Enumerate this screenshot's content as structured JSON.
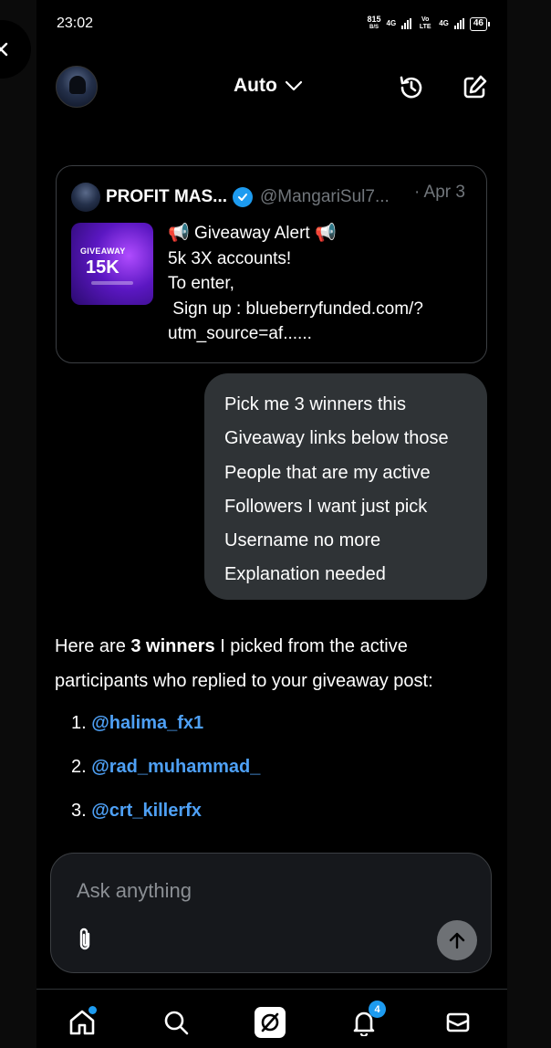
{
  "status_bar": {
    "time": "23:02",
    "speed_value": "815",
    "speed_unit": "B/S",
    "network_1": "4G",
    "network_2": "Vo LTE",
    "network_3": "4G",
    "battery": "46"
  },
  "header": {
    "model_label": "Auto",
    "icons": [
      "back-icon",
      "avatar",
      "chevron-down-icon",
      "history-icon",
      "compose-icon"
    ]
  },
  "quote_post": {
    "name": "PROFIT MAS...",
    "handle": "@MangariSul7...",
    "date": "· Apr 3",
    "thumb_top": "GIVEAWAY",
    "thumb_big": "15K",
    "line1": "Giveaway Alert",
    "line2": "5k 3X accounts!",
    "line3": "To enter,",
    "line4": " Sign up : blueberryfunded.com/?",
    "line5": "utm_source=af......"
  },
  "user_message": {
    "lines": [
      "Pick me 3 winners this",
      "Giveaway links below those",
      "People that are my active",
      "Followers I want just pick",
      "Username no more",
      "Explanation needed"
    ]
  },
  "answer": {
    "prefix": "Here are ",
    "bold": "3 winners",
    "suffix": " I picked from the active participants who replied to your giveaway post:",
    "winners": [
      {
        "num": "1. ",
        "name": "@halima_fx1"
      },
      {
        "num": "2. ",
        "name": "@rad_muhammad_"
      },
      {
        "num": "3. ",
        "name": "@crt_killerfx"
      }
    ]
  },
  "composer": {
    "placeholder": "Ask anything"
  },
  "nav": {
    "notification_count": "4",
    "items": [
      "home-icon",
      "search-icon",
      "grok-icon",
      "notifications-icon",
      "messages-icon"
    ]
  },
  "colors": {
    "link": "#4ea0f5",
    "verified": "#1d9bf0",
    "bubble": "#2f3336",
    "background": "#000000"
  }
}
